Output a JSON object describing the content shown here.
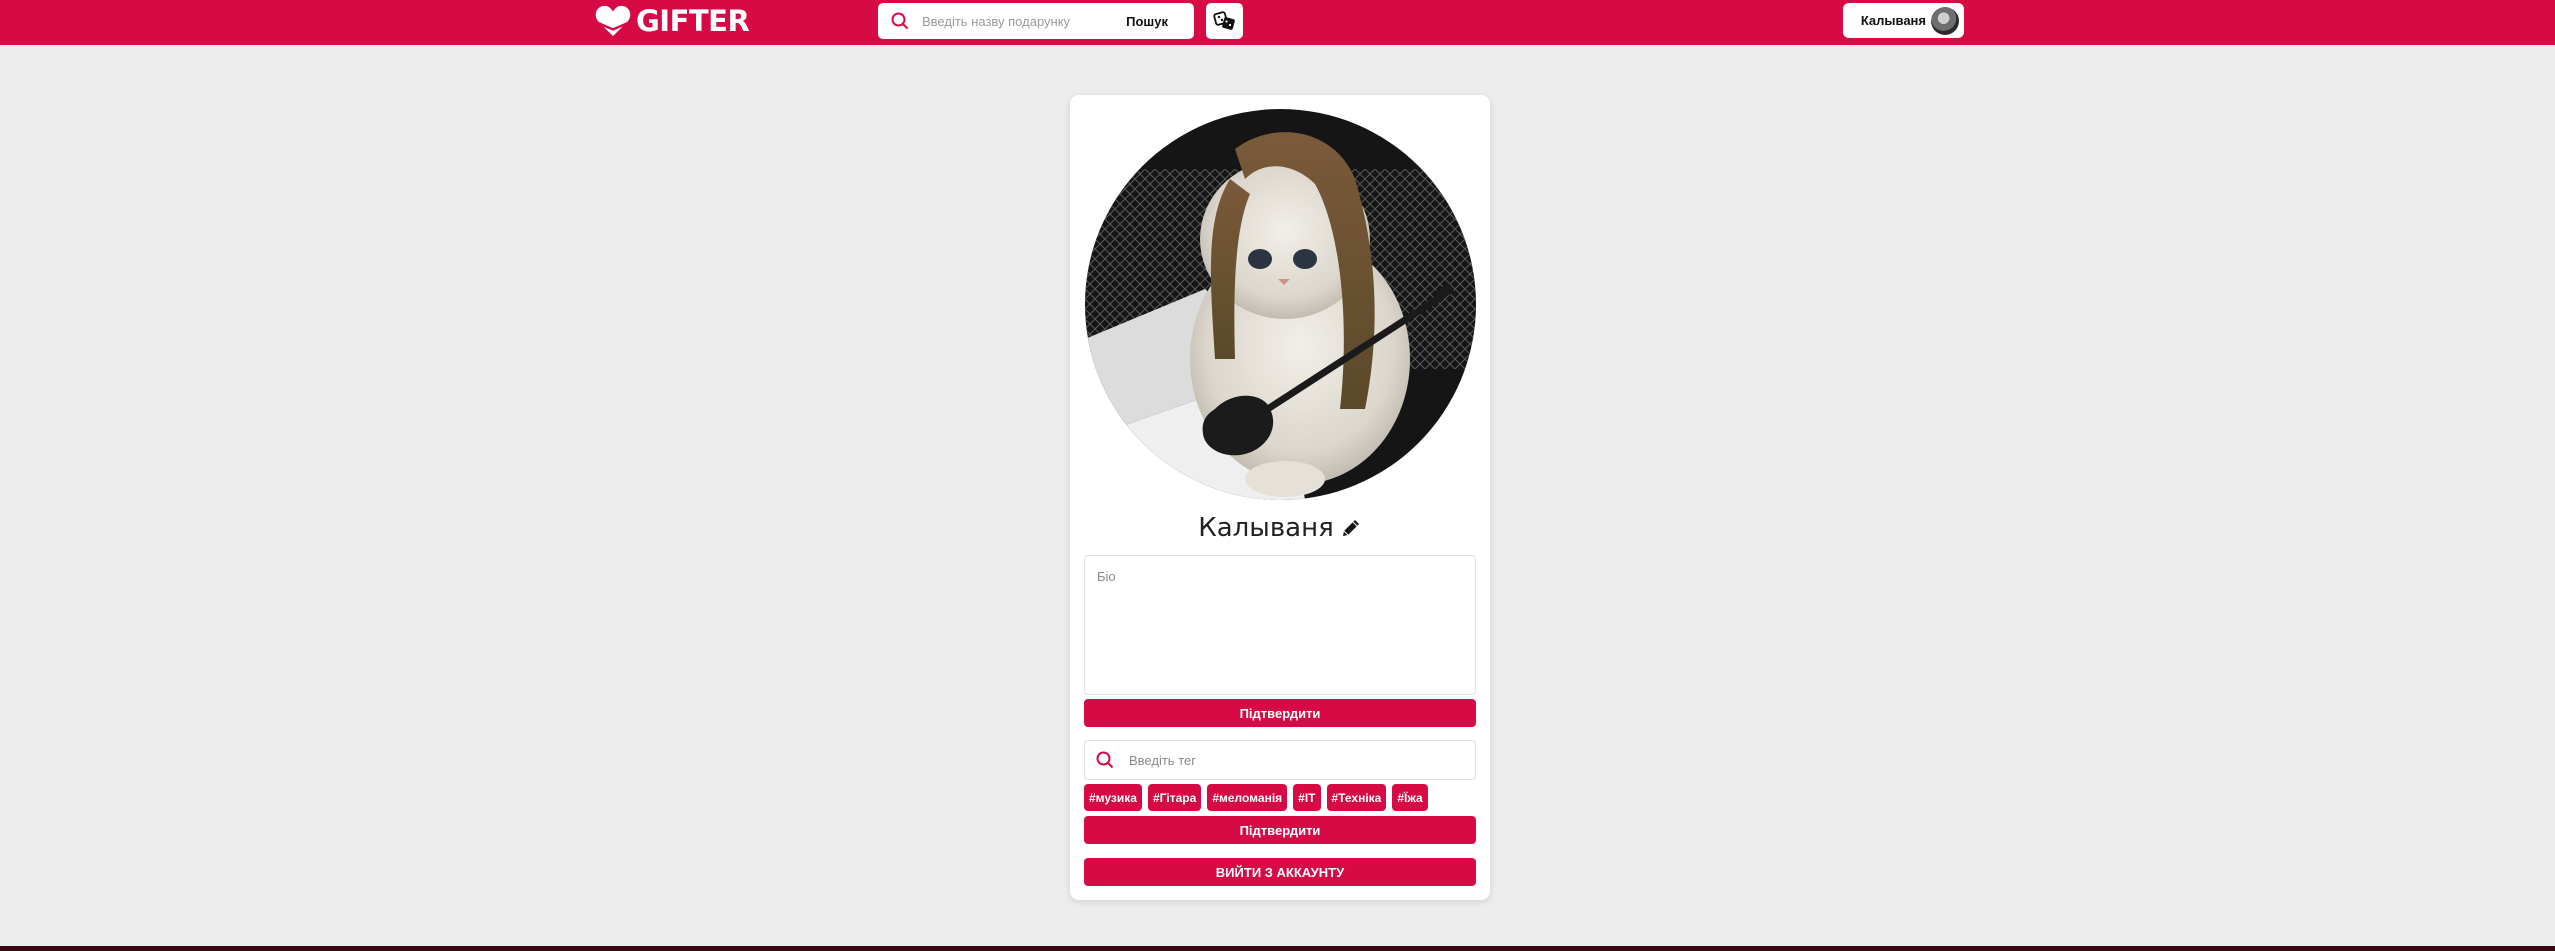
{
  "header": {
    "brand": "GIFTER",
    "search_placeholder": "Введіть назву подарунку",
    "search_button": "Пошук",
    "user_name": "Калываня"
  },
  "profile": {
    "name": "Калываня",
    "bio_placeholder": "Біо",
    "confirm_bio": "Підтвердити",
    "tag_placeholder": "Введіть тег",
    "tags": [
      "#музика",
      "#Гітара",
      "#меломанія",
      "#IT",
      "#Техніка",
      "#Їжа"
    ],
    "confirm_tags": "Підтвердити",
    "logout": "ВИЙТИ З АККАУНТУ"
  },
  "colors": {
    "brand": "#d60b45",
    "background": "#ededed"
  },
  "icons": [
    "heart-logo-icon",
    "search-icon",
    "dice-icon",
    "pencil-icon"
  ]
}
